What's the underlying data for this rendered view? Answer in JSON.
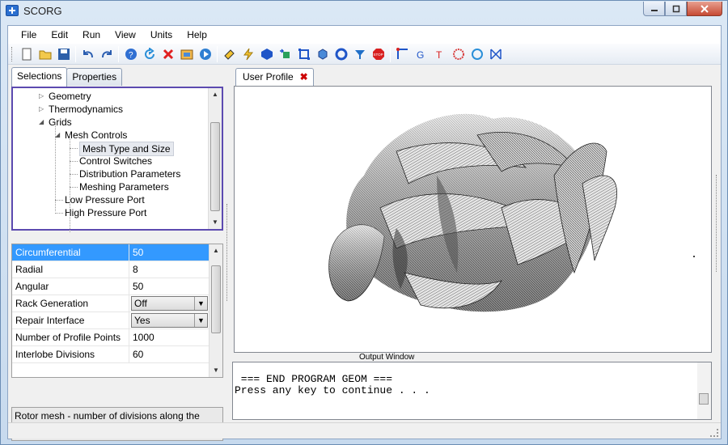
{
  "window": {
    "title": "SCORG"
  },
  "menu": [
    "File",
    "Edit",
    "Run",
    "View",
    "Units",
    "Help"
  ],
  "toolbar": {
    "buttons": [
      {
        "name": "new-icon"
      },
      {
        "name": "open-folder-icon"
      },
      {
        "name": "save-icon"
      },
      {
        "sep": true
      },
      {
        "name": "undo-icon"
      },
      {
        "name": "redo-icon"
      },
      {
        "sep": true
      },
      {
        "name": "help-icon"
      },
      {
        "name": "refresh-icon"
      },
      {
        "name": "delete-icon"
      },
      {
        "name": "screenshot-icon"
      },
      {
        "name": "play-icon"
      },
      {
        "sep": true
      },
      {
        "name": "pencil-icon"
      },
      {
        "name": "lightning-icon"
      },
      {
        "name": "solid-icon"
      },
      {
        "name": "grid-arrows-icon"
      },
      {
        "name": "bounding-box-icon"
      },
      {
        "name": "cube-icon"
      },
      {
        "name": "ring-icon"
      },
      {
        "name": "funnel-icon"
      },
      {
        "name": "stop-icon"
      },
      {
        "sep": true
      },
      {
        "name": "curve-icon"
      },
      {
        "name": "g-icon"
      },
      {
        "name": "t-icon"
      },
      {
        "name": "hatch-icon"
      },
      {
        "name": "circle-icon"
      },
      {
        "name": "bowtie-icon"
      }
    ],
    "stop_label": "STOP"
  },
  "left": {
    "tabs": [
      "Selections",
      "Properties"
    ],
    "tree": [
      {
        "label": "Geometry",
        "level": 1,
        "expander": "closed"
      },
      {
        "label": "Thermodynamics",
        "level": 1,
        "expander": "closed"
      },
      {
        "label": "Grids",
        "level": 1,
        "expander": "open"
      },
      {
        "label": "Mesh Controls",
        "level": 2,
        "expander": "open"
      },
      {
        "label": "Mesh Type and Size",
        "level": 3,
        "selected": true
      },
      {
        "label": "Control Switches",
        "level": 3
      },
      {
        "label": "Distribution Parameters",
        "level": 3
      },
      {
        "label": "Meshing Parameters",
        "level": 3
      },
      {
        "label": "Low Pressure Port",
        "level": 2
      },
      {
        "label": "High Pressure Port",
        "level": 2
      }
    ],
    "properties": [
      {
        "name": "Circumferential",
        "value": "50",
        "selected": true
      },
      {
        "name": "Radial",
        "value": "8"
      },
      {
        "name": "Angular",
        "value": "50"
      },
      {
        "name": "Rack Generation",
        "value": "Off",
        "combo": true
      },
      {
        "name": "Repair Interface",
        "value": "Yes",
        "combo": true
      },
      {
        "name": "Number of Profile Points",
        "value": "1000"
      },
      {
        "name": "Interlobe Divisions",
        "value": "60"
      }
    ],
    "description": "Rotor mesh - number of divisions along the lobe"
  },
  "document": {
    "tab": "User Profile",
    "output_label": "Output Window",
    "output_lines": [
      " === END PROGRAM GEOM ===",
      "Press any key to continue . . ."
    ]
  }
}
